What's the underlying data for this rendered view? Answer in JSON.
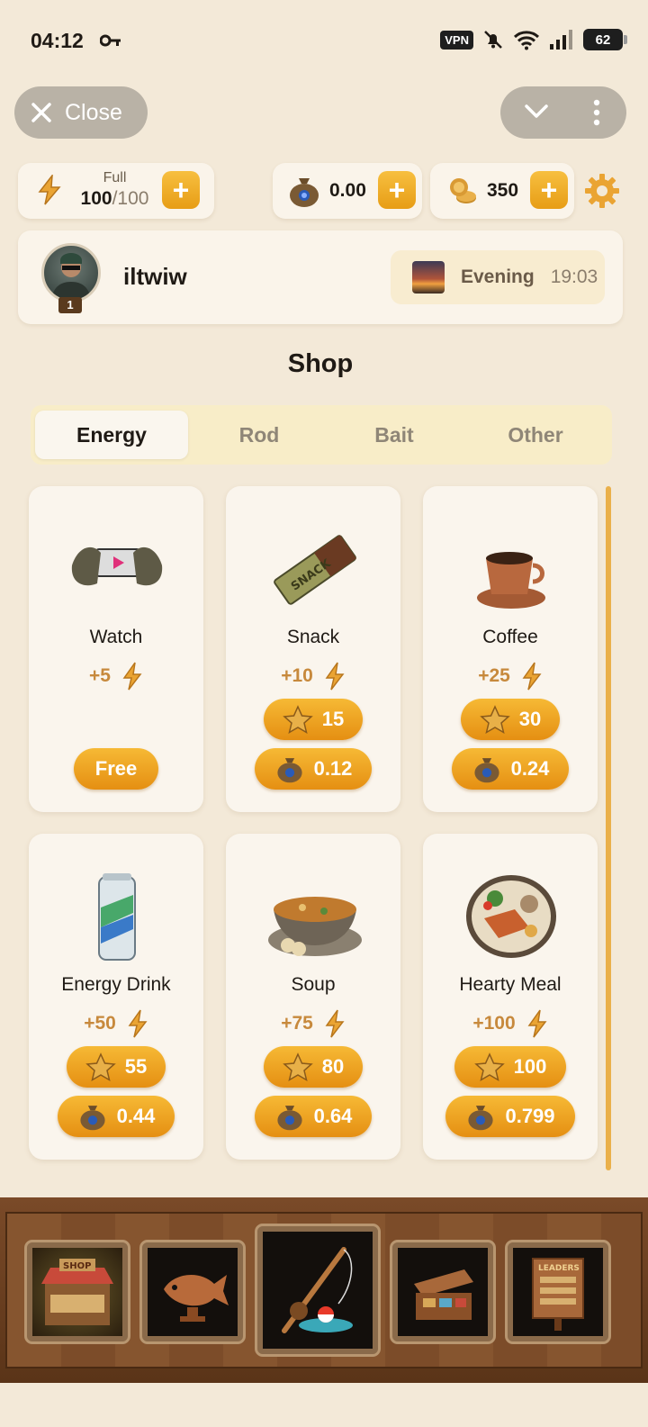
{
  "status_bar": {
    "time": "04:12",
    "vpn": "VPN",
    "battery": "62"
  },
  "header": {
    "close_label": "Close"
  },
  "resources": {
    "energy_caption": "Full",
    "energy_current": "100",
    "energy_max": "/100",
    "ton_balance": "0.00",
    "coins": "350",
    "plus": "+"
  },
  "profile": {
    "username": "iltwiw",
    "level": "1",
    "time_of_day": "Evening",
    "clock": "19:03"
  },
  "shop": {
    "title": "Shop",
    "tabs": [
      "Energy",
      "Rod",
      "Bait",
      "Other"
    ],
    "items": [
      {
        "name": "Watch",
        "gain": "+5",
        "free_label": "Free"
      },
      {
        "name": "Snack",
        "gain": "+10",
        "stars": "15",
        "ton": "0.12"
      },
      {
        "name": "Coffee",
        "gain": "+25",
        "stars": "30",
        "ton": "0.24"
      },
      {
        "name": "Energy Drink",
        "gain": "+50",
        "stars": "55",
        "ton": "0.44"
      },
      {
        "name": "Soup",
        "gain": "+75",
        "stars": "80",
        "ton": "0.64"
      },
      {
        "name": "Hearty Meal",
        "gain": "+100",
        "stars": "100",
        "ton": "0.799"
      }
    ]
  },
  "bottom_nav": {
    "shop_sign": "SHOP",
    "leaders_sign": "LEADERS"
  },
  "colors": {
    "accent": "#eba322",
    "background": "#f3e9d8",
    "card": "#faf5ed"
  }
}
